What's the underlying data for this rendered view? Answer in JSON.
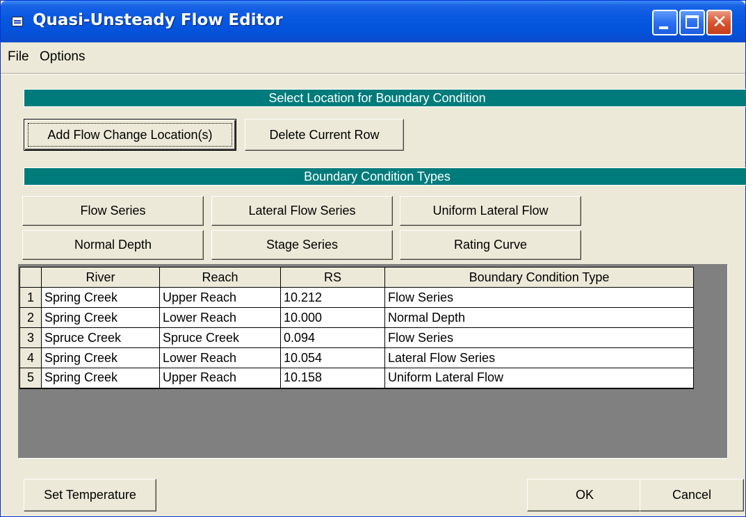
{
  "window": {
    "title": "Quasi-Unsteady Flow Editor"
  },
  "menu": {
    "items": [
      "File",
      "Options"
    ]
  },
  "location_section": {
    "header": "Select Location for Boundary Condition",
    "add_label": "Add Flow Change Location(s)",
    "delete_label": "Delete Current Row"
  },
  "bc_types": {
    "header": "Boundary Condition Types",
    "buttons": [
      "Flow Series",
      "Lateral Flow Series",
      "Uniform Lateral Flow",
      "Normal Depth",
      "Stage Series",
      "Rating Curve"
    ]
  },
  "table": {
    "columns": [
      "",
      "River",
      "Reach",
      "RS",
      "Boundary Condition Type"
    ],
    "rows": [
      [
        "1",
        "Spring Creek",
        "Upper Reach",
        "10.212",
        "Flow Series"
      ],
      [
        "2",
        "Spring Creek",
        "Lower Reach",
        "10.000",
        "Normal Depth"
      ],
      [
        "3",
        "Spruce Creek",
        "Spruce Creek",
        "0.094",
        "Flow Series"
      ],
      [
        "4",
        "Spring Creek",
        "Lower Reach",
        "10.054",
        "Lateral Flow Series"
      ],
      [
        "5",
        "Spring Creek",
        "Upper Reach",
        "10.158",
        "Uniform Lateral Flow"
      ]
    ]
  },
  "footer": {
    "set_temperature_label": "Set Temperature",
    "ok_label": "OK",
    "cancel_label": "Cancel"
  },
  "colors": {
    "section_bar": "#007b7b",
    "title_bar": "#0858e0",
    "grid_background": "#808080"
  }
}
